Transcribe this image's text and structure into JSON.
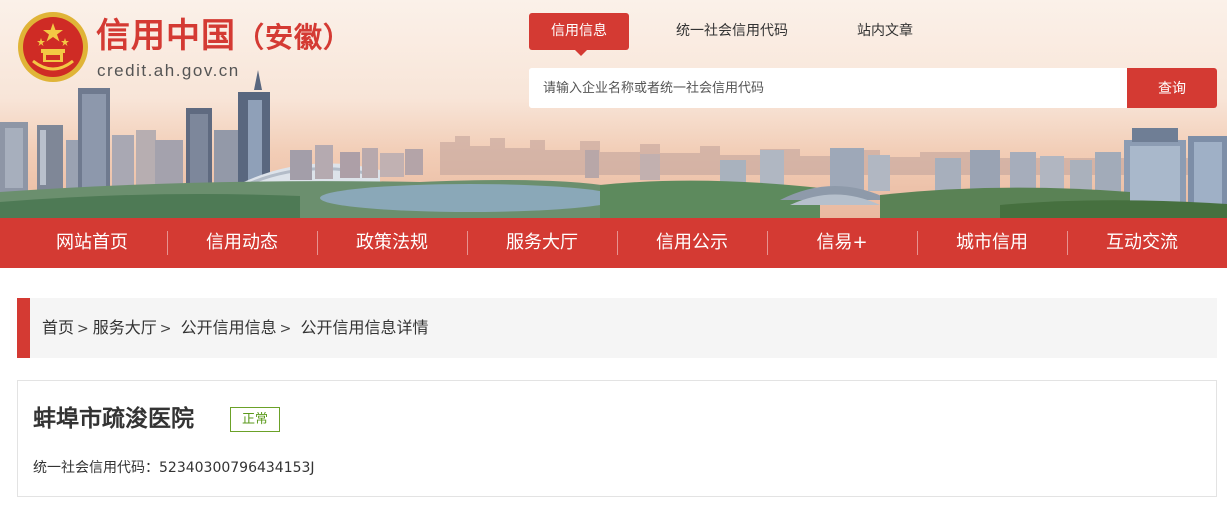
{
  "site": {
    "title": "信用中国",
    "region": "（安徽）",
    "domain": "credit.ah.gov.cn",
    "brand_color": "#d43a33",
    "emblem_icon": "national-emblem-icon"
  },
  "header_tabs": [
    {
      "label": "信用信息",
      "active": true
    },
    {
      "label": "统一社会信用代码",
      "active": false
    },
    {
      "label": "站内文章",
      "active": false
    }
  ],
  "search": {
    "placeholder": "请输入企业名称或者统一社会信用代码",
    "value": "",
    "button_label": "查询"
  },
  "nav": [
    "网站首页",
    "信用动态",
    "政策法规",
    "服务大厅",
    "信用公示",
    "信易+",
    "城市信用",
    "互动交流"
  ],
  "breadcrumb": [
    "首页",
    "服务大厅",
    "公开信用信息",
    "公开信用信息详情"
  ],
  "entity": {
    "name": "蚌埠市疏浚医院",
    "status": "正常",
    "status_color": "#6ba128",
    "credit_code_label": "统一社会信用代码：",
    "credit_code": "52340300796434153J"
  }
}
